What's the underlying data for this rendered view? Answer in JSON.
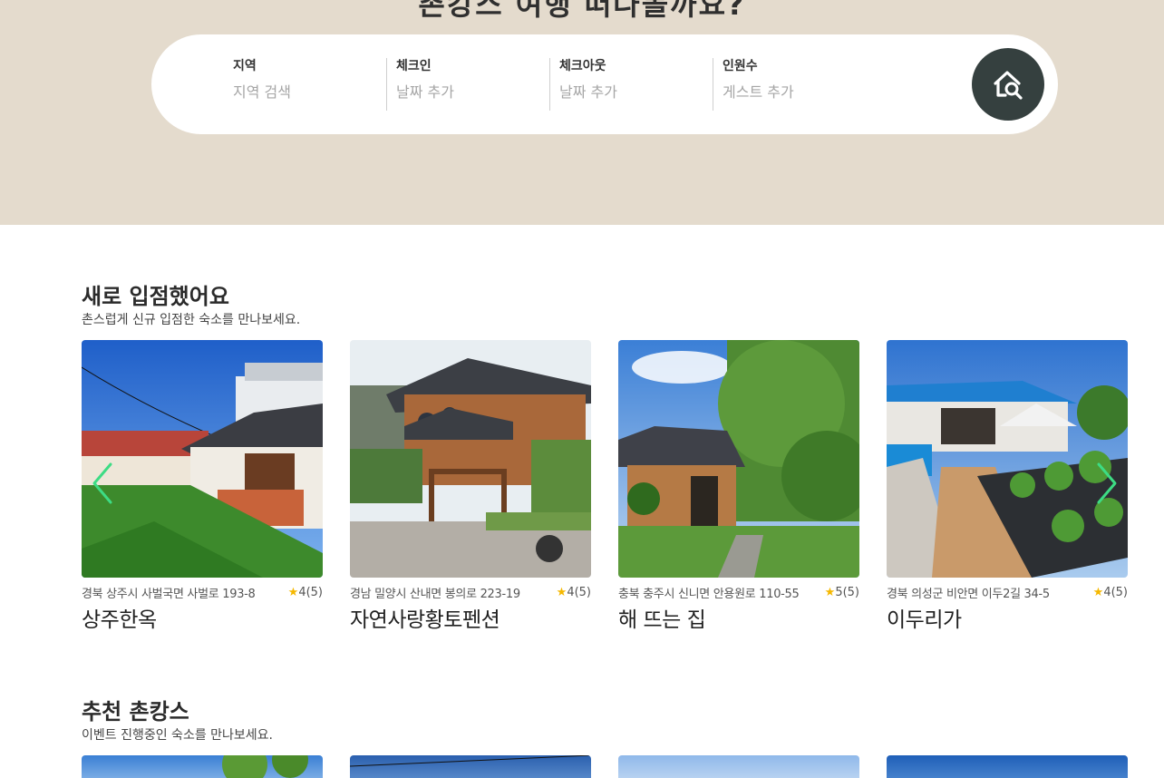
{
  "hero": {
    "title": "촌캉스 여행 떠나볼까요?"
  },
  "search": {
    "fields": [
      {
        "label": "지역",
        "placeholder": "지역 검색"
      },
      {
        "label": "체크인",
        "placeholder": "날짜 추가"
      },
      {
        "label": "체크아웃",
        "placeholder": "날짜 추가"
      },
      {
        "label": "인원수",
        "placeholder": "게스트 추가"
      }
    ],
    "button_icon": "home-search-icon"
  },
  "new_section": {
    "title": "새로 입점했어요",
    "subtitle": "촌스럽게 신규 입점한 숙소를 만나보세요.",
    "cards": [
      {
        "address": "경북 상주시 사벌국면 사벌로 193-8",
        "rating": "4(5)",
        "name": "상주한옥"
      },
      {
        "address": "경남 밀양시 산내면 봉의로 223-19",
        "rating": "4(5)",
        "name": "자연사랑황토펜션"
      },
      {
        "address": "충북 충주시 신니면 안용원로 110-55",
        "rating": "5(5)",
        "name": "해 뜨는 집"
      },
      {
        "address": "경북 의성군 비안면 이두2길 34-5",
        "rating": "4(5)",
        "name": "이두리가"
      }
    ]
  },
  "recommend_section": {
    "title": "추천 촌캉스",
    "subtitle": "이벤트 진행중인 숙소를 만나보세요."
  },
  "colors": {
    "hero_bg": "#e4dbcd",
    "search_button": "#35403f",
    "star": "#f5b800",
    "arrow": "#3ddc84"
  },
  "icons": {
    "star": "star-icon",
    "prev": "chevron-left-icon",
    "next": "chevron-right-icon"
  }
}
